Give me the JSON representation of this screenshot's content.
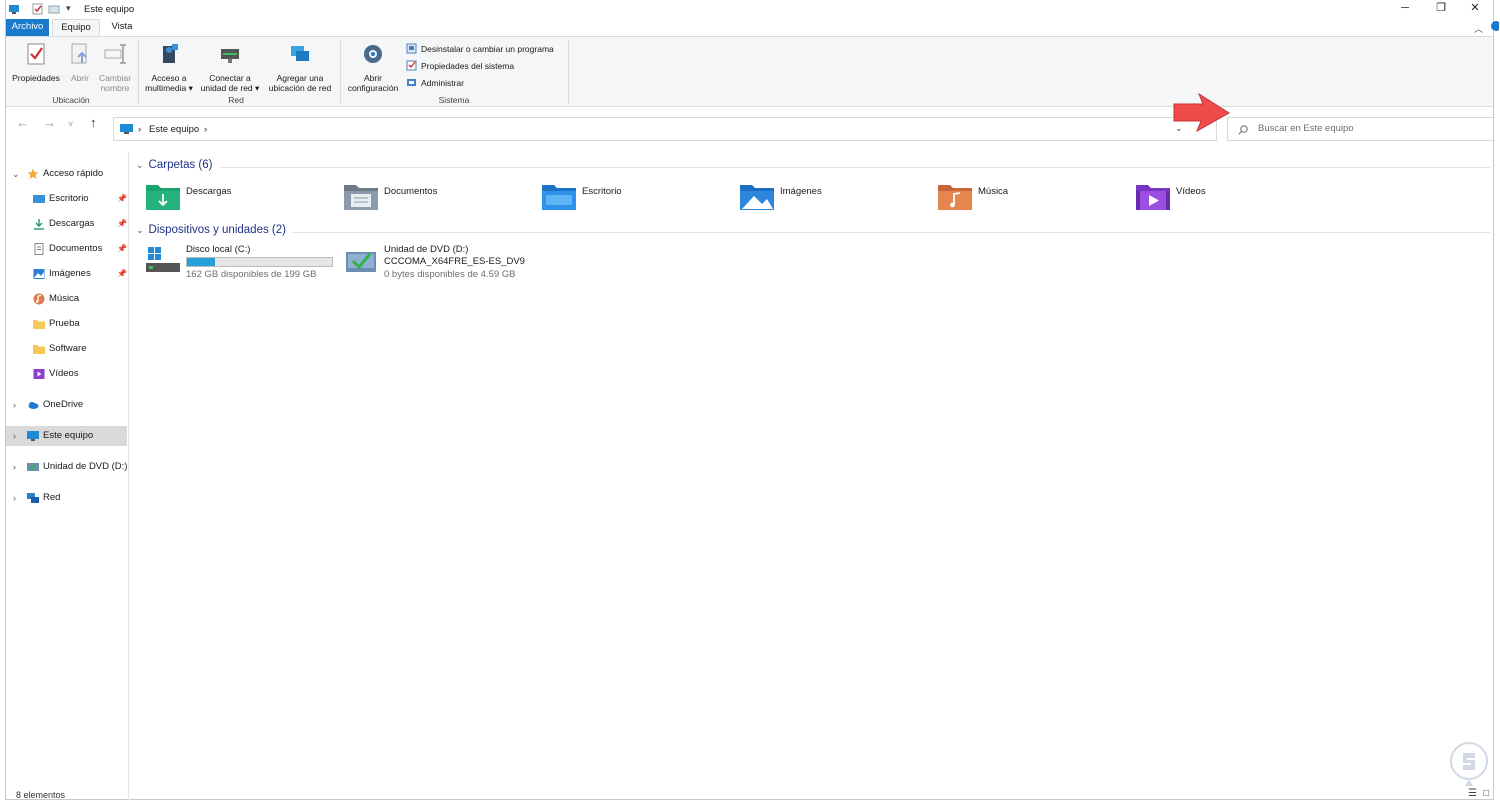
{
  "window": {
    "title": "Este equipo",
    "minimize": "─",
    "maximize": "❐",
    "close": "✕"
  },
  "ribbon_tabs": {
    "file": "Archivo",
    "computer": "Equipo",
    "view": "Vista"
  },
  "ribbon": {
    "ubicacion": {
      "label": "Ubicación",
      "properties": "Propiedades",
      "open": "Abrir",
      "rename_1": "Cambiar",
      "rename_2": "nombre"
    },
    "red": {
      "label": "Red",
      "media_1": "Acceso a",
      "media_2": "multimedia",
      "map_1": "Conectar a",
      "map_2": "unidad de red",
      "add_1": "Agregar una",
      "add_2": "ubicación de red"
    },
    "sistema": {
      "label": "Sistema",
      "settings_1": "Abrir",
      "settings_2": "configuración",
      "uninstall": "Desinstalar o cambiar un programa",
      "sysprops": "Propiedades del sistema",
      "manage": "Administrar"
    }
  },
  "address": {
    "crumb": "Este equipo",
    "separator": "›"
  },
  "search": {
    "placeholder": "Buscar en Este equipo"
  },
  "sidebar": {
    "quick_access": "Acceso rápido",
    "items": [
      "Escritorio",
      "Descargas",
      "Documentos",
      "Imágenes",
      "Música",
      "Prueba",
      "Software",
      "Vídeos"
    ],
    "onedrive": "OneDrive",
    "this_pc": "Este equipo",
    "dvd": "Unidad de DVD (D:) C",
    "network": "Red"
  },
  "folders_section": "Carpetas (6)",
  "folders": [
    "Descargas",
    "Documentos",
    "Escritorio",
    "Imágenes",
    "Música",
    "Vídeos"
  ],
  "devices_section": "Dispositivos y unidades (2)",
  "drives": [
    {
      "name": "Disco local (C:)",
      "free": "162 GB disponibles de 199 GB",
      "used_fraction": 0.19
    },
    {
      "name": "Unidad de DVD (D:)",
      "label": "CCCOMA_X64FRE_ES-ES_DV9",
      "free": "0 bytes disponibles de 4.59 GB"
    }
  ],
  "status": "8 elementos",
  "colors": {
    "accent": "#1979ca",
    "arrow": "#f04b4b",
    "section": "#1e3287"
  }
}
